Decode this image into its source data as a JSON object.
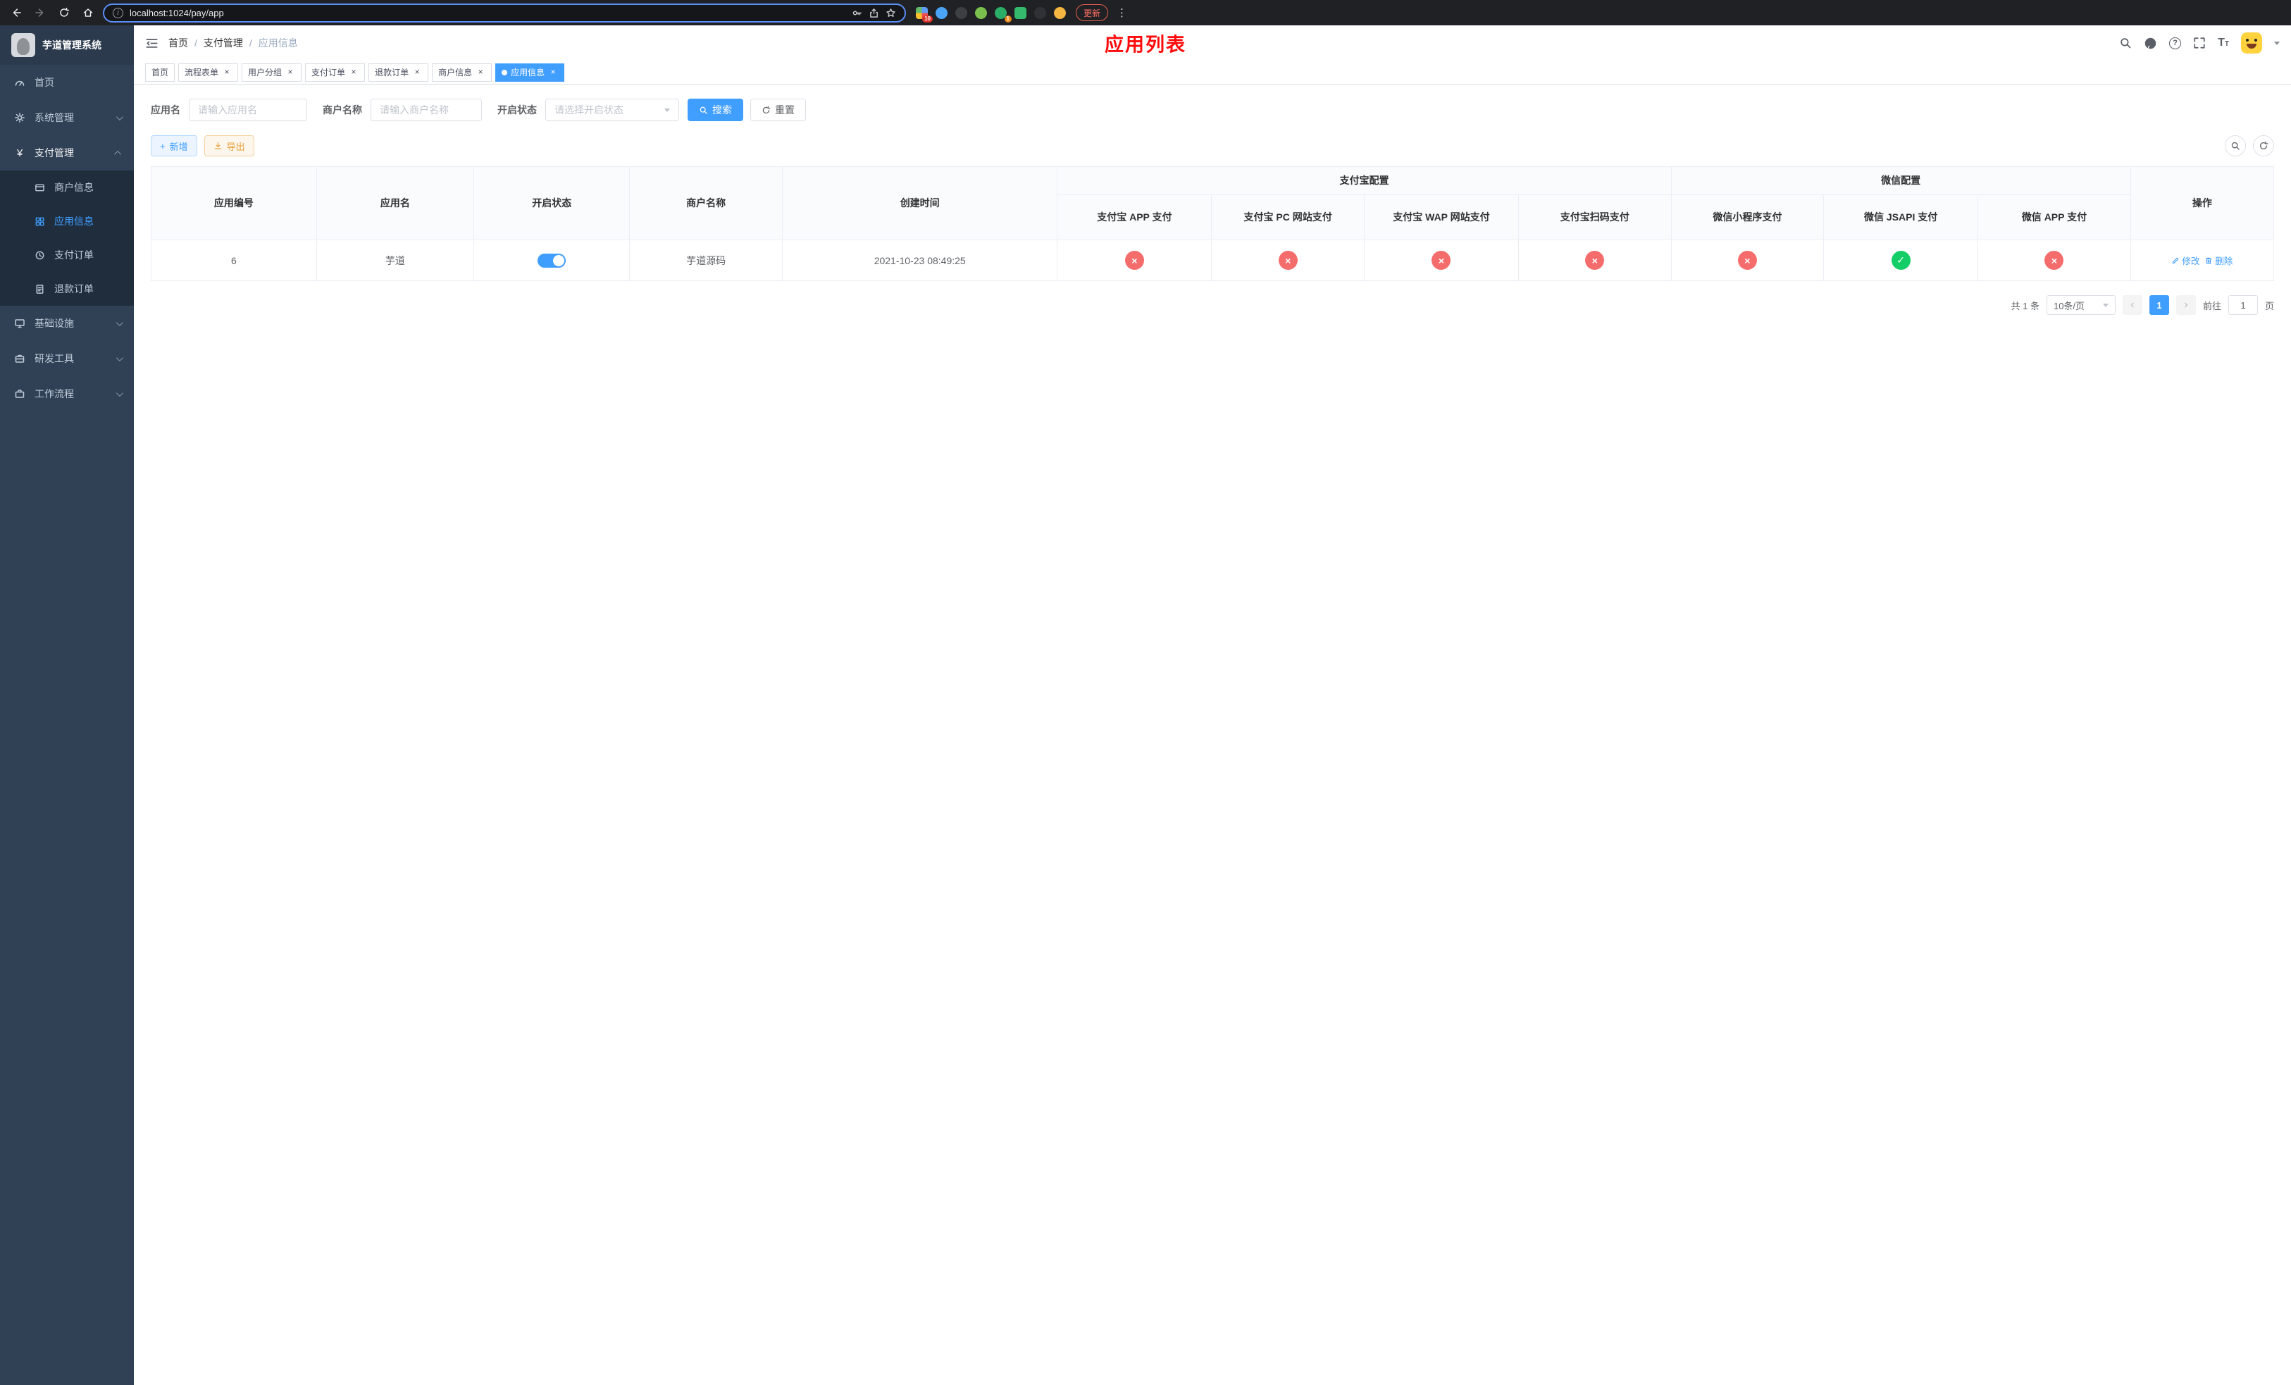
{
  "colors": {
    "primary": "#409eff",
    "success": "#13ce66",
    "danger": "#f56c6c",
    "warning": "#e6a23c",
    "title_red": "#ff0b0b"
  },
  "icons": {
    "close": "×",
    "check": "✓",
    "cross": "×",
    "prev": "‹",
    "next": "›",
    "ellipsis": "⋮",
    "question": "?",
    "info": "i",
    "sep": "/",
    "big_t": "T",
    "small_t": "T",
    "yen": "¥"
  },
  "browser": {
    "url": "localhost:1024/pay/app",
    "update_label": "更新",
    "grid_badge": "10",
    "chat_badge": "1"
  },
  "sidebar": {
    "title": "芋道管理系统",
    "home": "首页",
    "system": "系统管理",
    "pay": "支付管理",
    "merchant": "商户信息",
    "app": "应用信息",
    "order": "支付订单",
    "refund": "退款订单",
    "infra": "基础设施",
    "devtools": "研发工具",
    "workflow": "工作流程"
  },
  "navbar": {
    "breadcrumb": [
      "首页",
      "支付管理",
      "应用信息"
    ],
    "page_title": "应用列表"
  },
  "tabs": [
    {
      "label": "首页"
    },
    {
      "label": "流程表单"
    },
    {
      "label": "用户分组"
    },
    {
      "label": "支付订单"
    },
    {
      "label": "退款订单"
    },
    {
      "label": "商户信息"
    },
    {
      "label": "应用信息"
    }
  ],
  "filters": {
    "app_name_label": "应用名",
    "app_name_placeholder": "请输入应用名",
    "merchant_label": "商户名称",
    "merchant_placeholder": "请输入商户名称",
    "status_label": "开启状态",
    "status_placeholder": "请选择开启状态",
    "search_label": "搜索",
    "reset_label": "重置"
  },
  "toolbar": {
    "add_label": "新增",
    "export_label": "导出"
  },
  "table": {
    "headers": {
      "id": "应用编号",
      "name": "应用名",
      "status": "开启状态",
      "merchant": "商户名称",
      "created": "创建时间",
      "alipay_group": "支付宝配置",
      "wechat_group": "微信配置",
      "alipay_app": "支付宝 APP 支付",
      "alipay_pc": "支付宝 PC 网站支付",
      "alipay_wap": "支付宝 WAP 网站支付",
      "alipay_qr": "支付宝扫码支付",
      "wx_lite": "微信小程序支付",
      "wx_jsapi": "微信 JSAPI 支付",
      "wx_app": "微信 APP 支付",
      "actions": "操作"
    },
    "rows": [
      {
        "id": "6",
        "name": "芋道",
        "enabled": true,
        "merchant": "芋道源码",
        "created": "2021-10-23 08:49:25",
        "alipay_app": false,
        "alipay_pc": false,
        "alipay_wap": false,
        "alipay_qr": false,
        "wx_lite": false,
        "wx_jsapi": true,
        "wx_app": false,
        "edit_label": "修改",
        "delete_label": "删除"
      }
    ]
  },
  "pagination": {
    "total": "共 1 条",
    "page_size": "10条/页",
    "page": "1",
    "goto_label": "前往",
    "goto_value": "1",
    "goto_unit": "页"
  }
}
